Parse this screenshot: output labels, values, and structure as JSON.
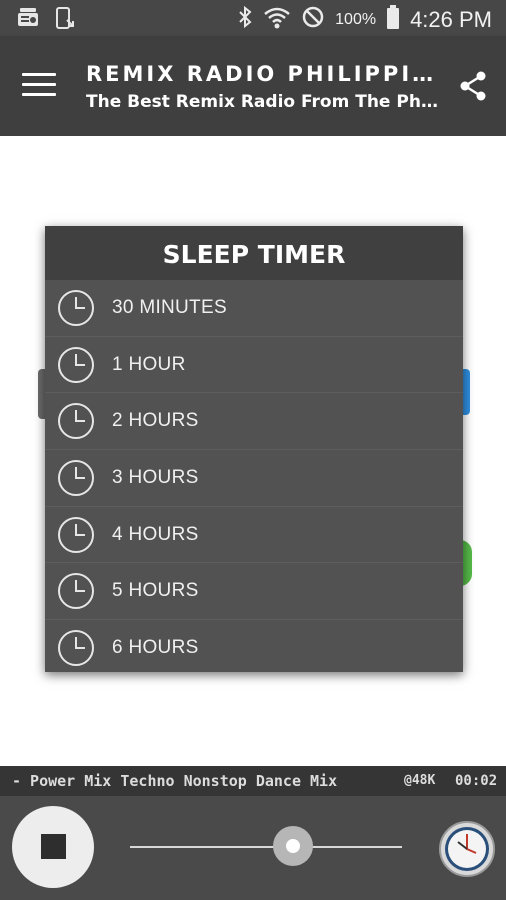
{
  "status_bar": {
    "battery": "100%",
    "time": "4:26 PM"
  },
  "app_bar": {
    "title": "REMIX RADIO PHILIPPINES",
    "subtitle": "The Best Remix Radio From The Philippines"
  },
  "dialog": {
    "title": "SLEEP TIMER",
    "options": [
      "30 MINUTES",
      "1 HOUR",
      "2 HOURS",
      "3 HOURS",
      "4 HOURS",
      "5 HOURS",
      "6 HOURS"
    ]
  },
  "ticker": {
    "text": "- Power Mix Techno Nonstop Dance Mix",
    "bitrate": "@48K",
    "elapsed": "00:02"
  },
  "player": {
    "volume_level": 0.6
  },
  "colors": {
    "status_bar": "#474747",
    "app_bar": "#3f3f3f",
    "dialog_bg": "#525252",
    "dialog_title_bg": "#404040",
    "player_bar": "#4a4a4a"
  }
}
